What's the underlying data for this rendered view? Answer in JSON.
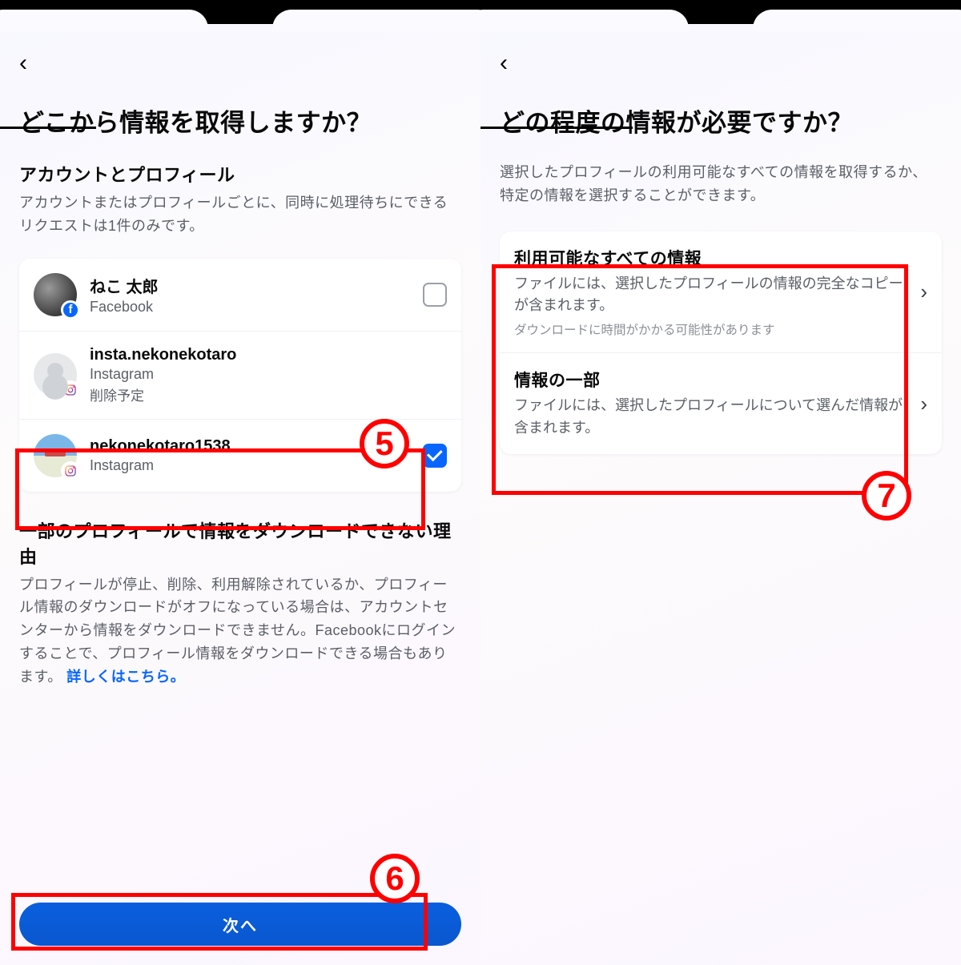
{
  "left": {
    "title": "どこから情報を取得しますか？",
    "accounts_heading": "アカウントとプロフィール",
    "accounts_desc": "アカウントまたはプロフィールごとに、同時に処理待ちにできるリクエストは1件のみです。",
    "rows": [
      {
        "name": "ねこ 太郎",
        "service": "Facebook",
        "note": "",
        "checked": false,
        "avatar": "cat",
        "badge": "fb"
      },
      {
        "name": "insta.nekonekotaro",
        "service": "Instagram",
        "note": "削除予定",
        "checked": null,
        "avatar": "blank",
        "badge": "ig"
      },
      {
        "name": "nekonekotaro1538",
        "service": "Instagram",
        "note": "",
        "checked": true,
        "avatar": "sky",
        "badge": "ig"
      }
    ],
    "reason_heading": "一部のプロフィールで情報をダウンロードできない理由",
    "reason_desc": "プロフィールが停止、削除、利用解除されているか、プロフィール情報のダウンロードがオフになっている場合は、アカウントセンターから情報をダウンロードできません。Facebookにログインすることで、プロフィール情報をダウンロードできる場合もあります。",
    "reason_link": "詳しくはこちら。",
    "next_button": "次へ"
  },
  "right": {
    "title": "どの程度の情報が必要ですか？",
    "desc": "選択したプロフィールの利用可能なすべての情報を取得するか、特定の情報を選択することができます。",
    "options": [
      {
        "title": "利用可能なすべての情報",
        "desc": "ファイルには、選択したプロフィールの情報の完全なコピーが含まれます。",
        "note": "ダウンロードに時間がかかる可能性があります"
      },
      {
        "title": "情報の一部",
        "desc": "ファイルには、選択したプロフィールについて選んだ情報が含まれます。",
        "note": ""
      }
    ]
  },
  "annotations": {
    "n5": "5",
    "n6": "6",
    "n7": "7"
  }
}
